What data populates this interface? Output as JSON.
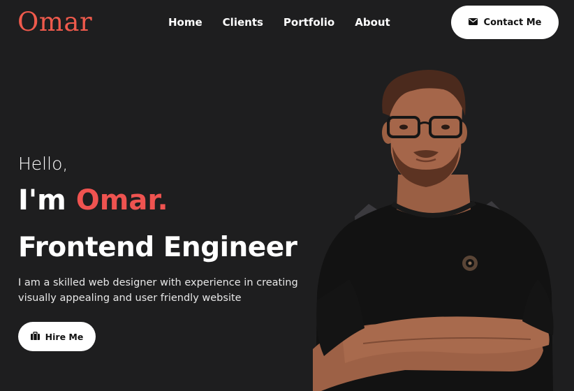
{
  "brand": {
    "logo_text": "Omar",
    "accent": "#ef5350"
  },
  "nav": {
    "items": [
      {
        "label": "Home"
      },
      {
        "label": "Clients"
      },
      {
        "label": "Portfolio"
      },
      {
        "label": "About"
      }
    ]
  },
  "contact_button": {
    "label": "Contact Me",
    "icon": "envelope-icon"
  },
  "hero": {
    "greeting": "Hello,",
    "intro_prefix": "I'm",
    "name": "Omar.",
    "role": "Frontend Engineer",
    "description": "I am a skilled web designer with experience in creating visually appealing and user friendly website",
    "hire_button": {
      "label": "Hire Me",
      "icon": "briefcase-icon"
    }
  },
  "colors": {
    "background": "#1e1e1f",
    "text": "#ffffff",
    "button_bg": "#ffffff"
  }
}
